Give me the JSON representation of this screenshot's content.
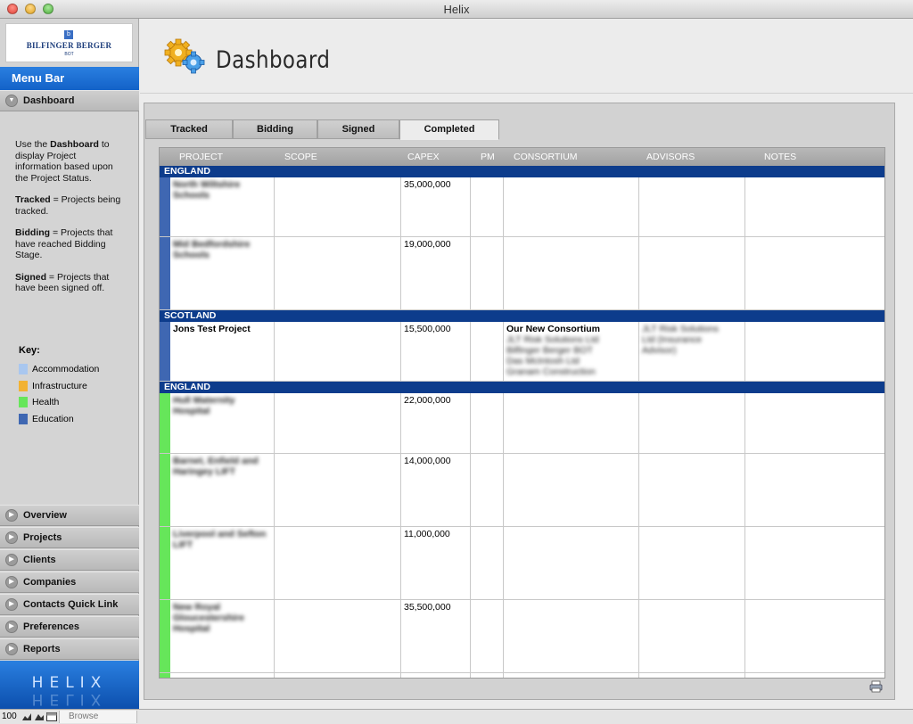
{
  "window": {
    "title": "Helix"
  },
  "sidebar": {
    "logo": {
      "mark": "b",
      "text": "BILFINGER BERGER",
      "sub": "BOT"
    },
    "menubar_label": "Menu Bar",
    "active_item": "Dashboard",
    "help": {
      "intro_prefix": "Use the ",
      "intro_bold": "Dashboard",
      "intro_rest": " to display Project information based upon the Project Status.",
      "tracked_bold": "Tracked",
      "tracked_rest": " = Projects being tracked.",
      "bidding_bold": "Bidding",
      "bidding_rest": " = Projects that have reached Bidding Stage.",
      "signed_bold": "Signed",
      "signed_rest": " = Projects that have been signed off."
    },
    "key": {
      "title": "Key:",
      "items": [
        {
          "label": "Accommodation",
          "color": "#a9c7ef"
        },
        {
          "label": "Infrastructure",
          "color": "#f2b233"
        },
        {
          "label": "Health",
          "color": "#66e65a"
        },
        {
          "label": "Education",
          "color": "#3f67b2"
        }
      ]
    },
    "nav_items": [
      {
        "label": "Overview"
      },
      {
        "label": "Projects"
      },
      {
        "label": "Clients"
      },
      {
        "label": "Companies"
      },
      {
        "label": "Contacts Quick Link"
      },
      {
        "label": "Preferences"
      },
      {
        "label": "Reports"
      }
    ],
    "brand": "HELIX"
  },
  "header": {
    "title": "Dashboard"
  },
  "tabs": [
    {
      "label": "Tracked"
    },
    {
      "label": "Bidding"
    },
    {
      "label": "Signed"
    },
    {
      "label": "Completed",
      "active": true
    }
  ],
  "table": {
    "columns": [
      "PROJECT",
      "SCOPE",
      "CAPEX",
      "PM",
      "CONSORTIUM",
      "ADVISORS",
      "NOTES"
    ],
    "groups": [
      {
        "region": "ENGLAND",
        "rows": [
          {
            "project": "North Wiltshire Schools",
            "capex": "35,000,000",
            "category": "Education",
            "blurred": true
          },
          {
            "project": "Mid Bedfordshire Schools",
            "capex": "19,000,000",
            "category": "Education",
            "blurred": true
          }
        ]
      },
      {
        "region": "SCOTLAND",
        "rows": [
          {
            "project": "Jons Test Project",
            "capex": "15,500,000",
            "category": "Education",
            "blurred": false,
            "consortium_title": "Our New Consortium",
            "consortium_members": [
              "JLT Risk Solutions Ltd",
              "Bilfinger Berger BOT",
              "Das McIntosh Ltd",
              "Granam Construction"
            ],
            "advisors": [
              "JLT Risk Solutions",
              "Ltd (Insurance",
              "Advisor)"
            ]
          }
        ]
      },
      {
        "region": "ENGLAND",
        "rows": [
          {
            "project": "Hull Maternity Hospital",
            "capex": "22,000,000",
            "category": "Health",
            "blurred": true
          },
          {
            "project": "Barnet, Enfield and Haringey LIFT",
            "capex": "14,000,000",
            "category": "Health",
            "blurred": true
          },
          {
            "project": "Liverpool and Sefton LIFT",
            "capex": "11,000,000",
            "category": "Health",
            "blurred": true
          },
          {
            "project": "New Royal Gloucestershire Hospital",
            "capex": "35,500,000",
            "category": "Health",
            "blurred": true
          }
        ]
      }
    ]
  },
  "statusbar": {
    "zoom": "100",
    "mode": "Browse"
  }
}
